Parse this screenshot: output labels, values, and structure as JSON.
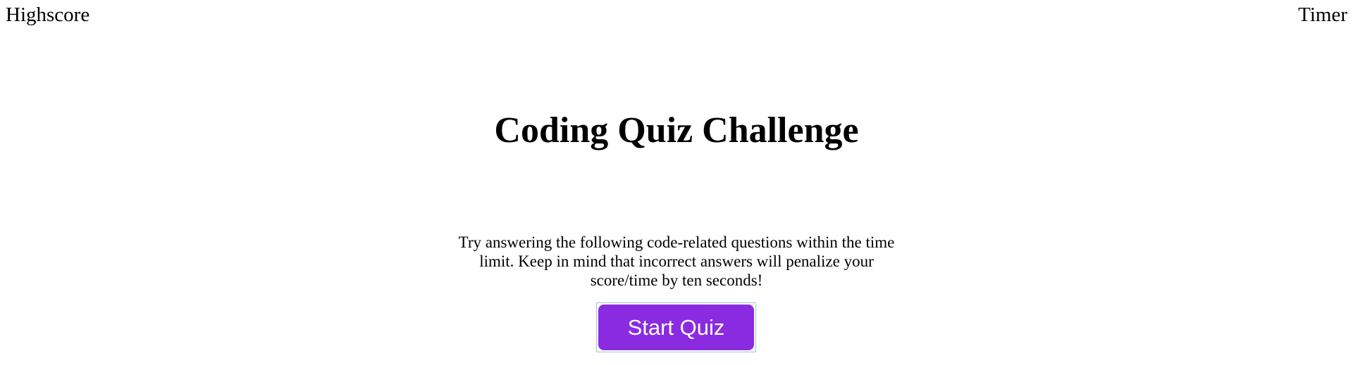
{
  "header": {
    "highscore_label": "Highscore",
    "timer_label": "Timer"
  },
  "main": {
    "title": "Coding Quiz Challenge",
    "intro": "Try answering the following code-related questions within the time limit. Keep in mind that incorrect answers will penalize your score/time by ten seconds!",
    "start_button_label": "Start Quiz"
  },
  "colors": {
    "start_button_bg": "#8a2be2",
    "start_button_text": "#ffffff",
    "focus_ring": "#9bbfe8"
  }
}
